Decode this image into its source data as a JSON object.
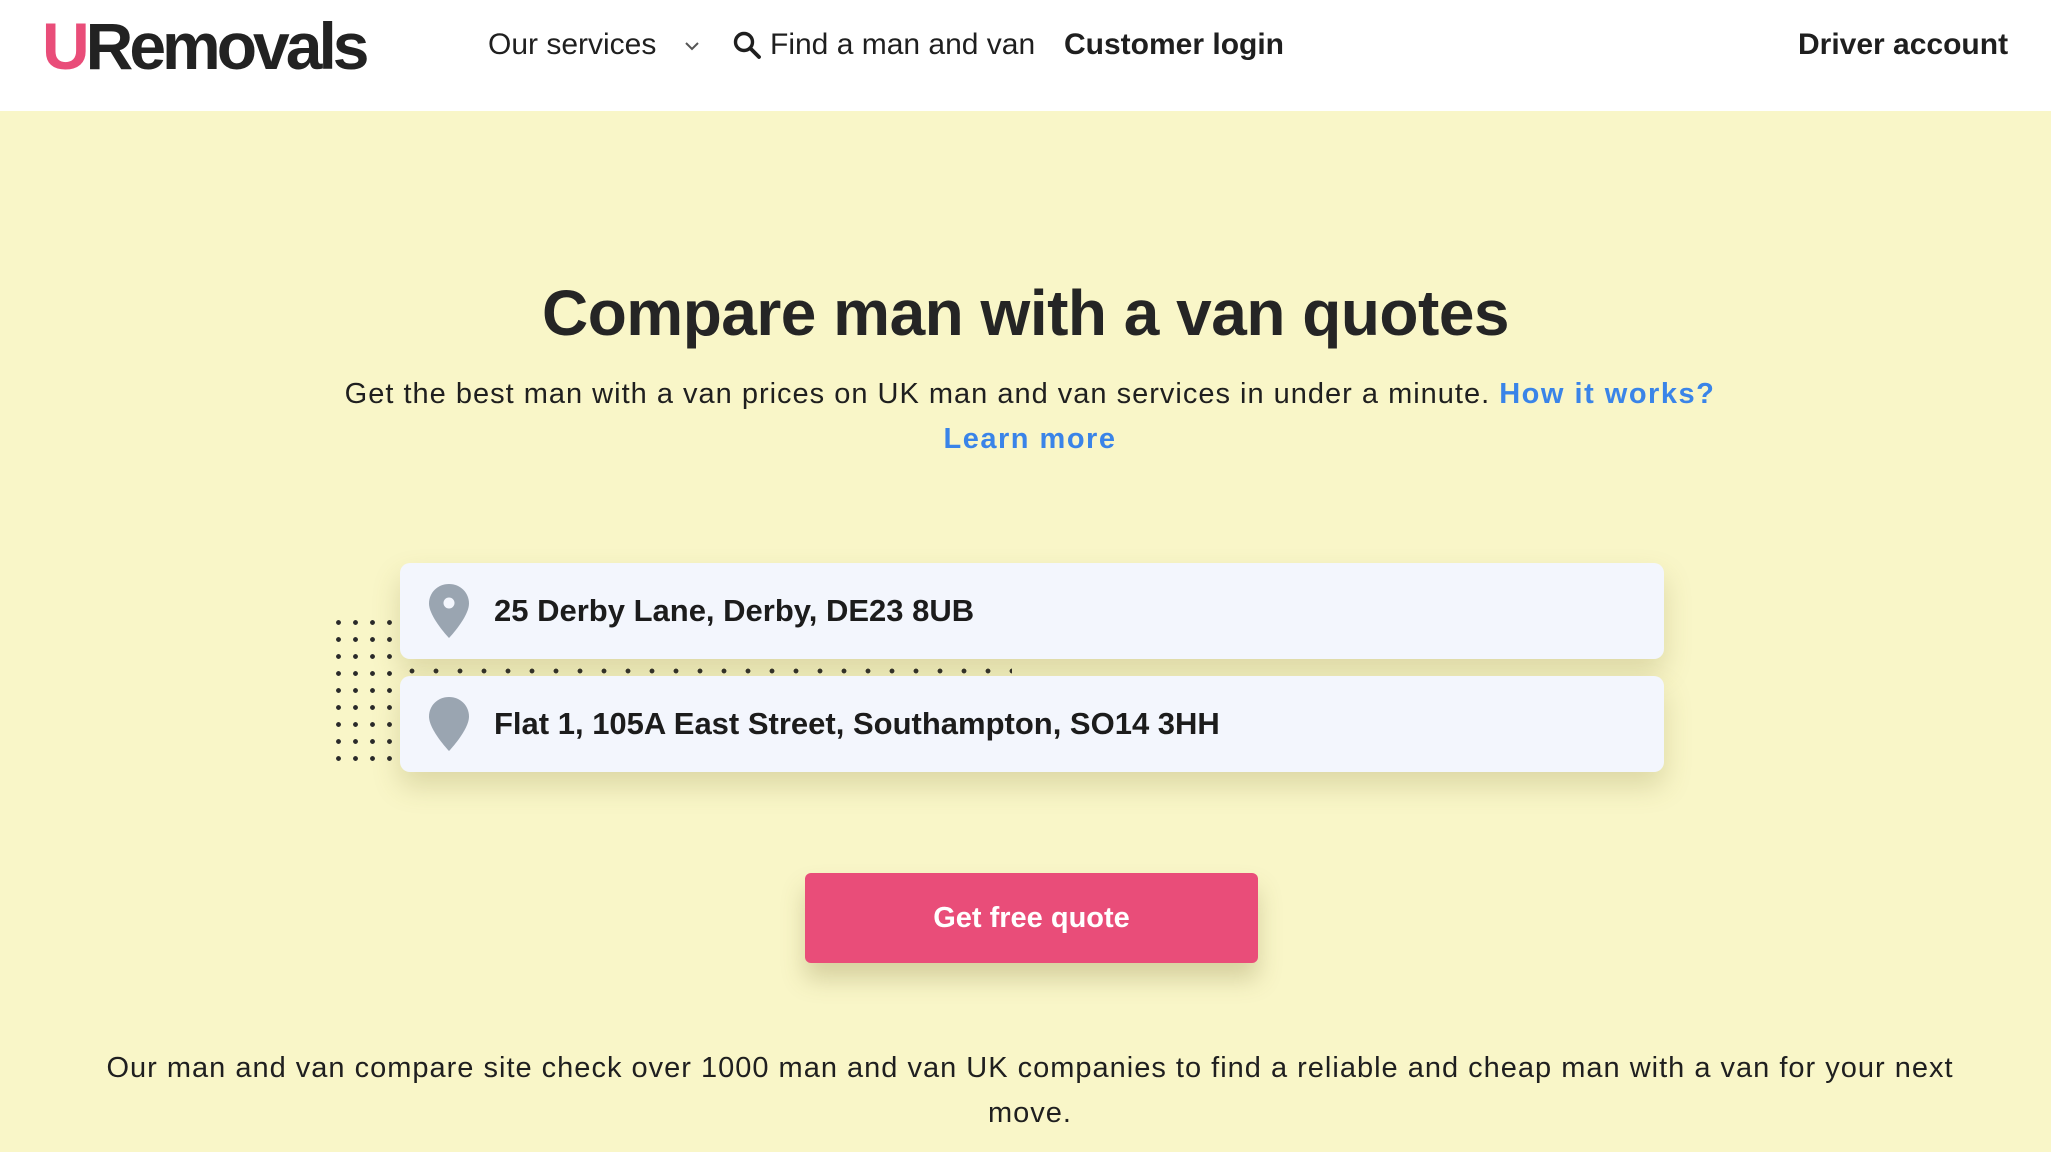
{
  "header": {
    "logo": {
      "first_letter": "U",
      "rest": "Removals"
    },
    "nav": {
      "services_label": "Our services",
      "find_label": "Find a man and van",
      "login_label": "Customer login",
      "driver_label": "Driver account"
    }
  },
  "hero": {
    "title": "Compare man with a van quotes",
    "subtitle": "Get the best man with a van prices on UK man and van services in under a minute.",
    "how_link": "How it works?",
    "learn_link": "Learn more"
  },
  "form": {
    "from_value": "25 Derby Lane, Derby, DE23 8UB",
    "to_value": "Flat 1, 105A East Street, Southampton, SO14 3HH",
    "submit_label": "Get free quote"
  },
  "footer_text": "Our man and van compare site check over 1000 man and van UK companies to find a reliable and cheap man with a van for your next move.",
  "colors": {
    "brand_pink": "#e94d79",
    "link_blue": "#3a84e8",
    "hero_bg": "#f9f6c8",
    "field_bg": "#f3f6fd",
    "pin_grey": "#9aa5b1"
  },
  "icons": [
    "chevron-down-icon",
    "search-icon",
    "location-pin-icon"
  ]
}
